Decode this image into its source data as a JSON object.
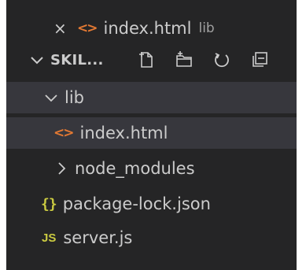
{
  "open_editors": {
    "close_glyph": "×",
    "file_icon": "html-icon",
    "file_name": "index.html",
    "folder_hint": "lib"
  },
  "explorer": {
    "title": "SKIL...",
    "actions": [
      "new-file-icon",
      "new-folder-icon",
      "refresh-icon",
      "collapse-all-icon"
    ]
  },
  "tree": [
    {
      "label": "lib",
      "type": "folder",
      "expanded": true
    },
    {
      "label": "index.html",
      "type": "file",
      "icon": "html-icon",
      "selected": true
    },
    {
      "label": "node_modules",
      "type": "folder",
      "expanded": false
    },
    {
      "label": "package-lock.json",
      "type": "file",
      "icon": "json-icon"
    },
    {
      "label": "server.js",
      "type": "file",
      "icon": "js-icon"
    }
  ],
  "icons": {
    "html_glyph": "<>",
    "json_glyph": "{}",
    "js_glyph": "JS"
  },
  "colors": {
    "background": "#252526",
    "selection": "#37373d",
    "text": "#cccccc",
    "html_icon": "#e37933",
    "json_js_icon": "#cbcb41"
  }
}
